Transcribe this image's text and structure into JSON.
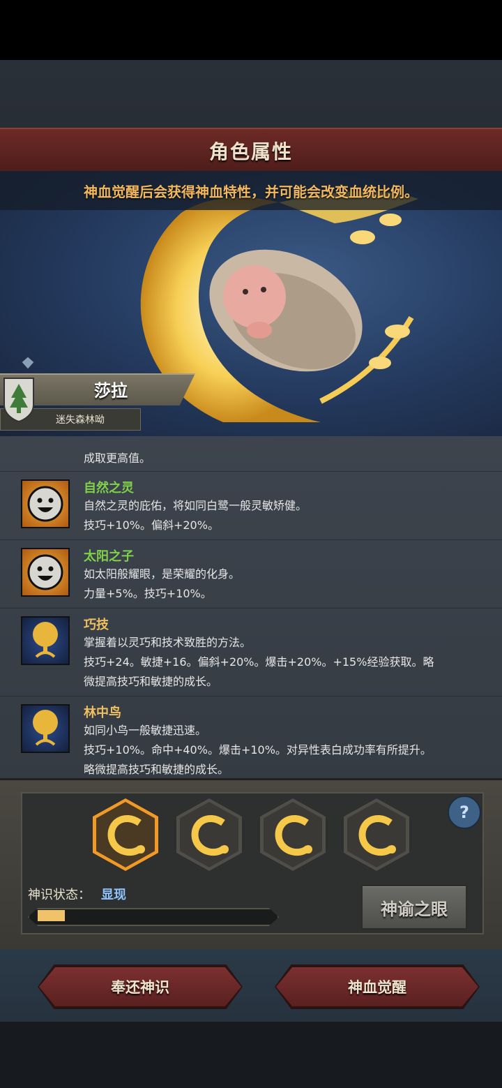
{
  "header": {
    "title": "角色属性"
  },
  "notice": "神血觉醒后会获得神血特性，并可能会改变血统比例。",
  "character": {
    "name": "莎拉",
    "origin": "迷失森林呦"
  },
  "traits": {
    "partial_line": "成取更高值。",
    "items": [
      {
        "name": "自然之灵",
        "name_color": "#7fd14a",
        "icon": "smiley-face-icon",
        "line1": "自然之灵的庇佑，将如同白鹭一般灵敏矫健。",
        "line2": "技巧+10%。偏斜+20%。"
      },
      {
        "name": "太阳之子",
        "name_color": "#7fd14a",
        "icon": "smiley-face-icon",
        "line1": "如太阳般耀眼，是荣耀的化身。",
        "line2": "力量+5%。技巧+10%。"
      },
      {
        "name": "巧技",
        "name_color": "#f0c060",
        "icon": "golden-tree-icon",
        "line1": "掌握着以灵巧和技术致胜的方法。",
        "line2": "技巧+24。敏捷+16。偏斜+20%。爆击+20%。+15%经验获取。略",
        "line3": "微提高技巧和敏捷的成长。"
      },
      {
        "name": "林中鸟",
        "name_color": "#f0c060",
        "icon": "golden-tree-icon",
        "line1": "如同小鸟一般敏捷迅速。",
        "line2": "技巧+10%。命中+40%。爆击+10%。对异性表白成功率有所提升。",
        "line3": "略微提高技巧和敏捷的成长。"
      }
    ]
  },
  "deity": {
    "status_label": "神识状态：",
    "status_value": "显现",
    "progress": 0.12,
    "eye_button": "神谕之眼",
    "help": "?"
  },
  "actions": {
    "return_label": "奉还神识",
    "awaken_label": "神血觉醒"
  },
  "colors": {
    "accent_gold": "#f0c36a",
    "banner_red": "#6e2a26",
    "status_blue": "#8fc4ff"
  }
}
